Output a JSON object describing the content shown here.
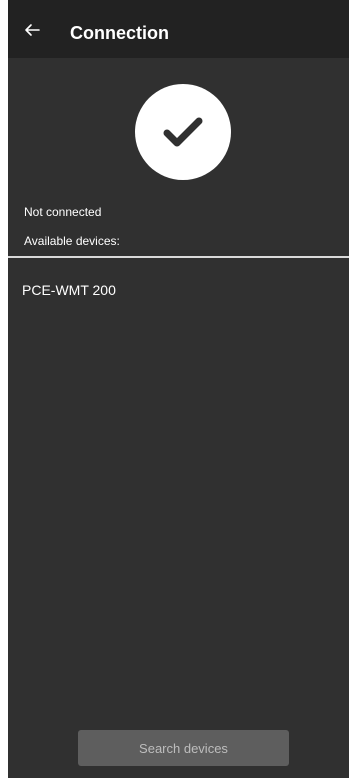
{
  "appbar": {
    "title": "Connection",
    "back_icon": "arrow-left-icon"
  },
  "status": {
    "icon": "checkmark-icon",
    "text": "Not connected"
  },
  "devices": {
    "label": "Available devices:",
    "items": [
      {
        "name": "PCE-WMT 200"
      }
    ]
  },
  "actions": {
    "search_label": "Search devices"
  },
  "colors": {
    "background": "#303030",
    "appbar": "#222222",
    "divider": "#d9d9d9",
    "button": "#5e5e5e",
    "button_text": "#bdbdbd"
  }
}
